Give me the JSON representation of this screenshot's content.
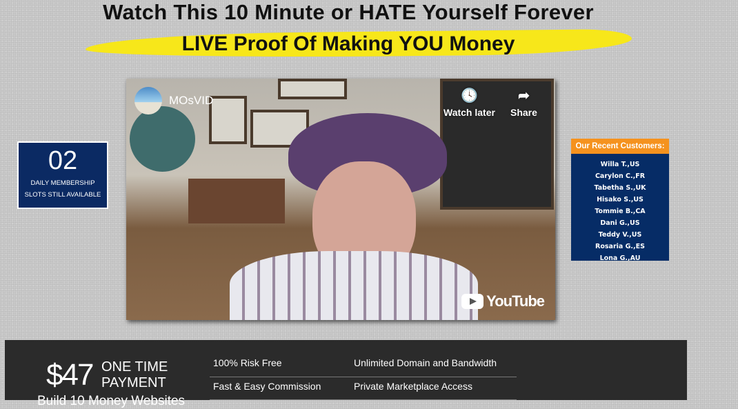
{
  "headline": "Watch This 10 Minute or HATE Yourself Forever",
  "subheadline": "LIVE Proof Of Making YOU Money",
  "video": {
    "channel": "MOsVID",
    "watch_later": "Watch later",
    "share": "Share",
    "brand": "YouTube"
  },
  "slots": {
    "count": "02",
    "line1": "DAILY MEMBERSHIP",
    "line2": "SLOTS STILL AVAILABLE"
  },
  "customers": {
    "title": "Our Recent Customers:",
    "items": [
      "Willa T.,US",
      "Carylon C.,FR",
      "Tabetha S.,UK",
      "Hisako S.,US",
      "Tommie B.,CA",
      "Dani G.,US",
      "Teddy V.,US",
      "Rosaria G.,ES",
      "Lona G.,AU"
    ]
  },
  "offer": {
    "price": "$47",
    "payment_line1": "ONE TIME",
    "payment_line2": "PAYMENT",
    "build": "Build 10 Money Websites",
    "features": [
      "100% Risk Free",
      "Unlimited Domain and Bandwidth",
      "Fast & Easy Commission",
      "Private Marketplace Access"
    ]
  }
}
